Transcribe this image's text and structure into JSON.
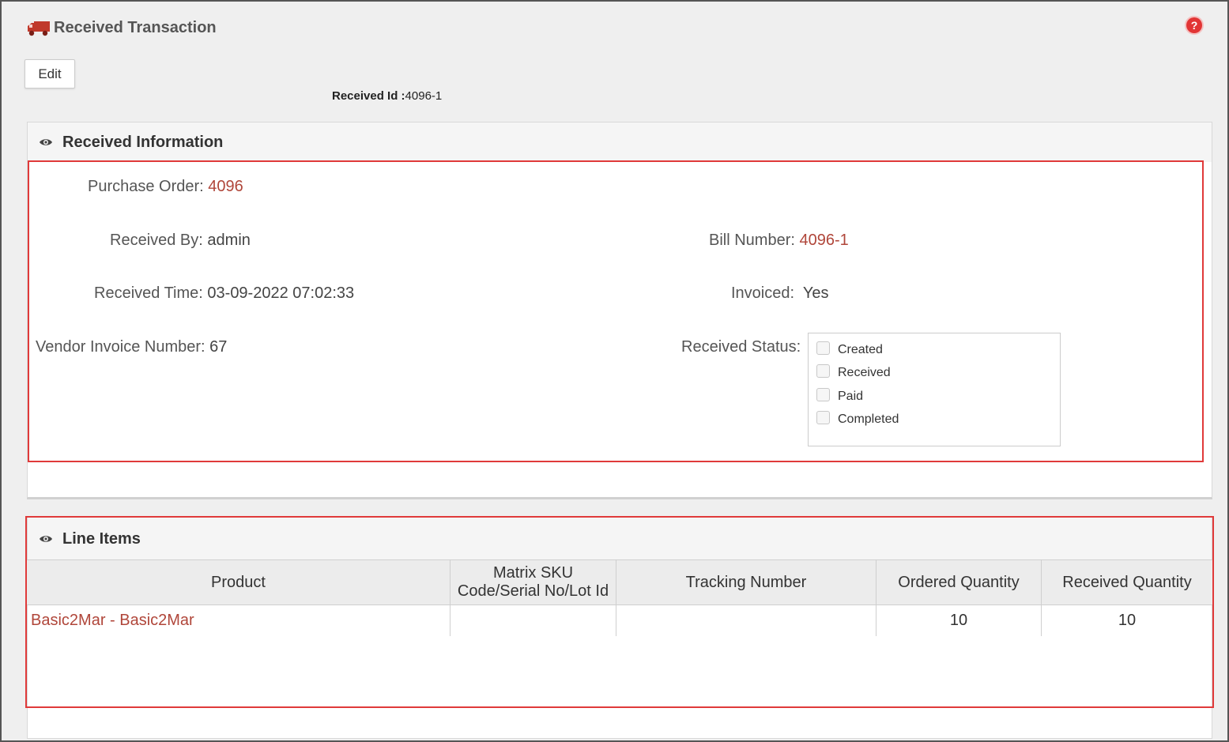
{
  "header": {
    "title": "Received Transaction",
    "help_icon": "question-circle-icon",
    "truck_icon": "truck-icon"
  },
  "toolbar": {
    "edit_label": "Edit"
  },
  "received_id": {
    "label": "Received Id :",
    "value": "4096-1"
  },
  "received_info": {
    "title": "Received Information",
    "purchase_order": {
      "label": "Purchase Order:",
      "value": "4096"
    },
    "received_by": {
      "label": "Received By:",
      "value": "admin"
    },
    "bill_number": {
      "label": "Bill Number:",
      "value": "4096-1"
    },
    "received_time": {
      "label": "Received Time:",
      "value": "03-09-2022 07:02:33"
    },
    "invoiced": {
      "label": "Invoiced:",
      "value": "Yes"
    },
    "vendor_invoice": {
      "label": "Vendor Invoice Number:",
      "value": "67"
    },
    "received_status": {
      "label": "Received Status:",
      "options": [
        {
          "label": "Created",
          "checked": false
        },
        {
          "label": "Received",
          "checked": false
        },
        {
          "label": "Paid",
          "checked": false
        },
        {
          "label": "Completed",
          "checked": false
        }
      ]
    }
  },
  "line_items": {
    "title": "Line Items",
    "columns": [
      "Product",
      "Matrix SKU Code/Serial No/Lot Id",
      "Tracking Number",
      "Ordered Quantity",
      "Received Quantity"
    ],
    "rows": [
      {
        "product": "Basic2Mar - Basic2Mar",
        "sku": "",
        "tracking": "",
        "ordered": "10",
        "received": "10"
      }
    ]
  },
  "colors": {
    "link": "#b0463a",
    "highlight_border": "#e03a3a",
    "help": "#e23535"
  }
}
